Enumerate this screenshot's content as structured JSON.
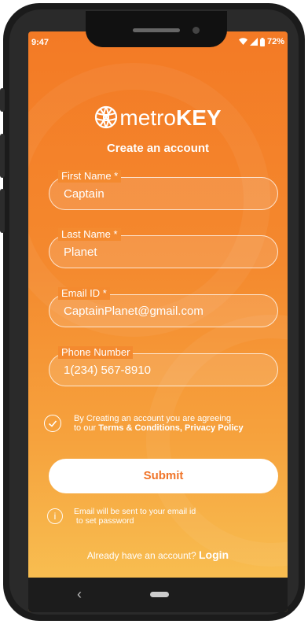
{
  "status_bar": {
    "time": "9:47",
    "battery": "72%"
  },
  "brand": {
    "name_light": "metro",
    "name_bold": "KEY",
    "subtitle": "Create an account"
  },
  "form": {
    "first_name": {
      "label": "First Name *",
      "value": "Captain"
    },
    "last_name": {
      "label": "Last Name *",
      "value": "Planet"
    },
    "email": {
      "label": "Email ID *",
      "value": "CaptainPlanet@gmail.com"
    },
    "phone": {
      "label": "Phone Number",
      "value": "1(234) 567-8910"
    }
  },
  "agreement": {
    "line1": "By Creating an account you are agreeing",
    "prefix": "to our ",
    "terms": "Terms & Conditions",
    "separator": ", ",
    "privacy": "Privacy Policy",
    "checked": true
  },
  "submit_label": "Submit",
  "info": {
    "line1": "Email will be sent to your email id",
    "line2": "to set password"
  },
  "login": {
    "prompt": "Already have an account?",
    "link": "Login"
  },
  "colors": {
    "accent": "#f37a25",
    "gradient_end": "#f8c455"
  }
}
